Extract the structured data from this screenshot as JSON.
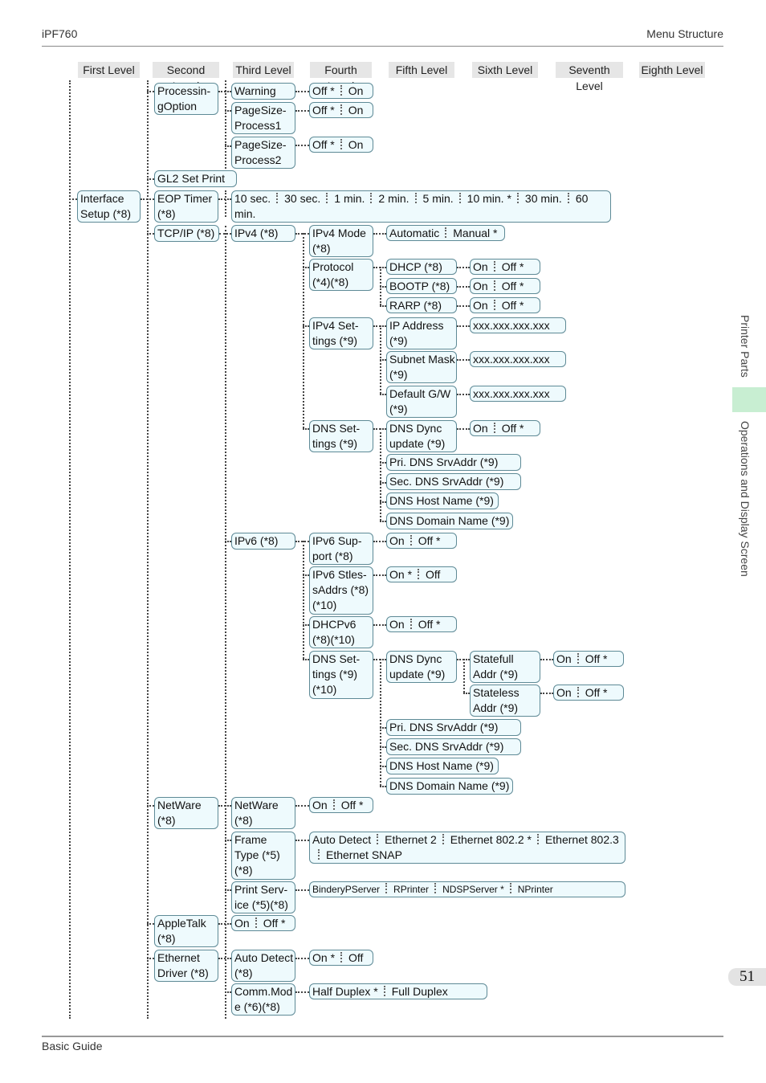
{
  "header": {
    "product": "iPF760",
    "section": "Menu Structure"
  },
  "footer": {
    "guide": "Basic Guide",
    "page_number": "51"
  },
  "side_tabs": {
    "top": "Printer Parts",
    "bottom": "Operations and Display Screen"
  },
  "levels": [
    "First Level",
    "Second Level",
    "Third Level",
    "Fourth Level",
    "Fifth Level",
    "Sixth Level",
    "Seventh Level",
    "Eighth Level"
  ],
  "nodes": {
    "processing_option": "Processin-\ngOption",
    "warning": "Warning",
    "warning_opts": [
      "Off *",
      "On"
    ],
    "pagesize1": "PageSize-\nProcess1",
    "pagesize1_opts": [
      "Off *",
      "On"
    ],
    "pagesize2": "PageSize-\nProcess2",
    "pagesize2_opts": [
      "Off *",
      "On"
    ],
    "gl2": "GL2 Set Print",
    "interface_setup": "Interface\nSetup (*8)",
    "eop_timer": "EOP Timer\n(*8)",
    "eop_opts": [
      "10 sec.",
      "30 sec.",
      "1 min.",
      "2 min.",
      "5 min.",
      "10 min. *",
      "30 min.",
      "60"
    ],
    "eop_wrap": "min.",
    "tcpip": "TCP/IP (*8)",
    "ipv4": "IPv4 (*8)",
    "ipv4_mode": "IPv4 Mode\n(*8)",
    "ipv4_mode_opts": [
      "Automatic",
      "Manual *"
    ],
    "protocol": "Protocol\n(*4)(*8)",
    "dhcp": "DHCP (*8)",
    "dhcp_opts": [
      "On",
      "Off *"
    ],
    "bootp": "BOOTP (*8)",
    "bootp_opts": [
      "On",
      "Off *"
    ],
    "rarp": "RARP (*8)",
    "rarp_opts": [
      "On",
      "Off *"
    ],
    "ipv4_settings": "IPv4 Set-\ntings (*9)",
    "ip_address": "IP Address\n(*9)",
    "ip_address_val": "xxx.xxx.xxx.xxx",
    "subnet_mask": "Subnet Mask\n(*9)",
    "subnet_mask_val": "xxx.xxx.xxx.xxx",
    "default_gw": "Default G/W\n(*9)",
    "default_gw_val": "xxx.xxx.xxx.xxx",
    "dns_settings4": "DNS Set-\ntings (*9)",
    "dns_dync4": "DNS Dync\nupdate (*9)",
    "dns_dync4_opts": [
      "On",
      "Off *"
    ],
    "pri_dns4": "Pri. DNS SrvAddr (*9)",
    "sec_dns4": "Sec. DNS SrvAddr (*9)",
    "dns_host4": "DNS Host Name (*9)",
    "dns_domain4": "DNS Domain Name (*9)",
    "ipv6": "IPv6 (*8)",
    "ipv6_support": "IPv6 Sup-\nport (*8)",
    "ipv6_support_opts": [
      "On",
      "Off *"
    ],
    "ipv6_stless": "IPv6 Stles-\nsAddrs (*8)\n(*10)",
    "ipv6_stless_opts": [
      "On *",
      "Off"
    ],
    "dhcpv6": "DHCPv6\n(*8)(*10)",
    "dhcpv6_opts": [
      "On",
      "Off *"
    ],
    "dns_settings6": "DNS Set-\ntings (*9)\n(*10)",
    "dns_dync6": "DNS Dync\nupdate (*9)",
    "statefull": "Statefull\nAddr (*9)",
    "statefull_opts": [
      "On",
      "Off *"
    ],
    "stateless": "Stateless\nAddr (*9)",
    "stateless_opts": [
      "On",
      "Off *"
    ],
    "pri_dns6": "Pri. DNS SrvAddr (*9)",
    "sec_dns6": "Sec. DNS SrvAddr (*9)",
    "dns_host6": "DNS Host Name (*9)",
    "dns_domain6": "DNS Domain Name (*9)",
    "netware2": "NetWare\n(*8)",
    "netware3": "NetWare\n(*8)",
    "netware3_opts": [
      "On",
      "Off *"
    ],
    "frame_type": "Frame\nType (*5)\n(*8)",
    "frame_type_opts": [
      "Auto Detect",
      "Ethernet 2",
      "Ethernet 802.2 *",
      "Ethernet 802.3"
    ],
    "frame_type_opts2": [
      "",
      "Ethernet SNAP"
    ],
    "print_service": "Print Serv-\nice (*5)(*8)",
    "print_service_opts": [
      "BinderyPServer",
      "RPrinter",
      "NDSPServer *",
      "NPrinter"
    ],
    "appletalk": "AppleTalk\n(*8)",
    "appletalk_opts": [
      "On",
      "Off *"
    ],
    "eth_driver": "Ethernet\nDriver (*8)",
    "auto_detect": "Auto Detect\n(*8)",
    "auto_detect_opts": [
      "On *",
      "Off"
    ],
    "comm_mode": "Comm.Mod\ne (*6)(*8)",
    "comm_mode_opts": [
      "Half Duplex *",
      "Full Duplex"
    ]
  }
}
